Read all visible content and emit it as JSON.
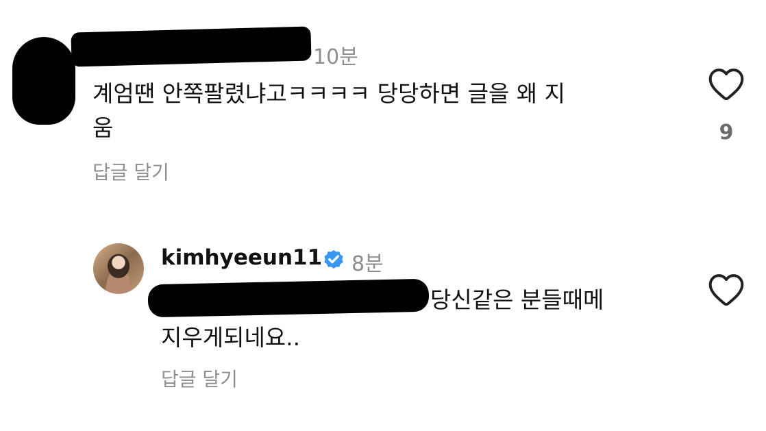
{
  "comment1": {
    "time": "10분",
    "text_line1": "계엄땐 안쪽팔렸냐고ㅋㅋㅋㅋ 당당하면  글을 왜 지",
    "text_line2": "움",
    "reply_label": "답글 달기",
    "like_count": "9"
  },
  "comment2": {
    "username": "kimhyeeun11",
    "time": "8분",
    "text_line1": "당신같은 분들때메",
    "text_line2": "지우게되네요..",
    "reply_label": "답글 달기"
  },
  "icons": {
    "like": "heart-outline-icon",
    "verified": "verified-badge-icon",
    "verified_color": "#3897f0"
  }
}
